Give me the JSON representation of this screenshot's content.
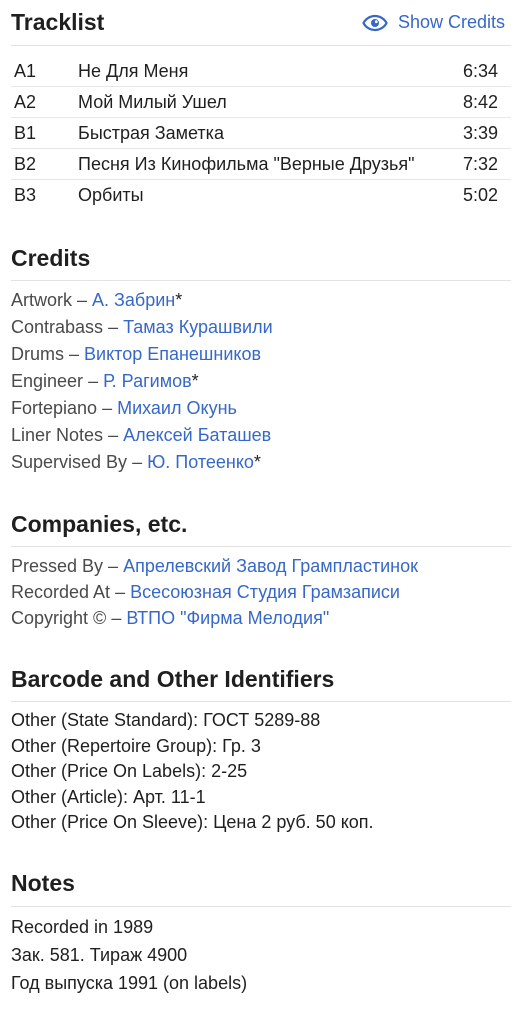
{
  "tracklist": {
    "title": "Tracklist",
    "show_credits_label": "Show Credits",
    "show_credits_icon": "eye-icon",
    "accent_color": "#3768c8",
    "tracks": [
      {
        "position": "A1",
        "title": "Не Для Меня",
        "duration": "6:34"
      },
      {
        "position": "A2",
        "title": "Мой Милый Ушел",
        "duration": "8:42"
      },
      {
        "position": "B1",
        "title": "Быстрая Заметка",
        "duration": "3:39"
      },
      {
        "position": "B2",
        "title": "Песня Из Кинофильма \"Верные Друзья\"",
        "duration": "7:32"
      },
      {
        "position": "B3",
        "title": "Орбиты",
        "duration": "5:02"
      }
    ]
  },
  "credits": {
    "title": "Credits",
    "items": [
      {
        "role": "Artwork",
        "name": "А. Забрин",
        "suffix": "*"
      },
      {
        "role": "Contrabass",
        "name": "Тамаз Курашвили",
        "suffix": ""
      },
      {
        "role": "Drums",
        "name": "Виктор Епанешников",
        "suffix": ""
      },
      {
        "role": "Engineer",
        "name": "Р. Рагимов",
        "suffix": "*"
      },
      {
        "role": "Fortepiano",
        "name": "Михаил Окунь",
        "suffix": ""
      },
      {
        "role": "Liner Notes",
        "name": "Алексей Баташев",
        "suffix": ""
      },
      {
        "role": "Supervised By",
        "name": "Ю. Потеенко",
        "suffix": "*"
      }
    ]
  },
  "companies": {
    "title": "Companies, etc.",
    "items": [
      {
        "role": "Pressed By",
        "name": "Апрелевский Завод Грампластинок"
      },
      {
        "role": "Recorded At",
        "name": "Всесоюзная Студия Грамзаписи"
      },
      {
        "role": "Copyright ©",
        "name": "ВТПО \"Фирма Мелодия\""
      }
    ]
  },
  "identifiers": {
    "title": "Barcode and Other Identifiers",
    "items": [
      "Other (State Standard): ГОСТ 5289-88",
      "Other (Repertoire Group): Гр. 3",
      "Other (Price On Labels): 2-25",
      "Other (Article): Арт. 11-1",
      "Other (Price On Sleeve): Цена 2 руб. 50 коп."
    ]
  },
  "notes": {
    "title": "Notes",
    "lines": [
      "Recorded in 1989",
      "Зак. 581. Тираж 4900",
      "Год выпуска 1991 (on labels)"
    ]
  }
}
